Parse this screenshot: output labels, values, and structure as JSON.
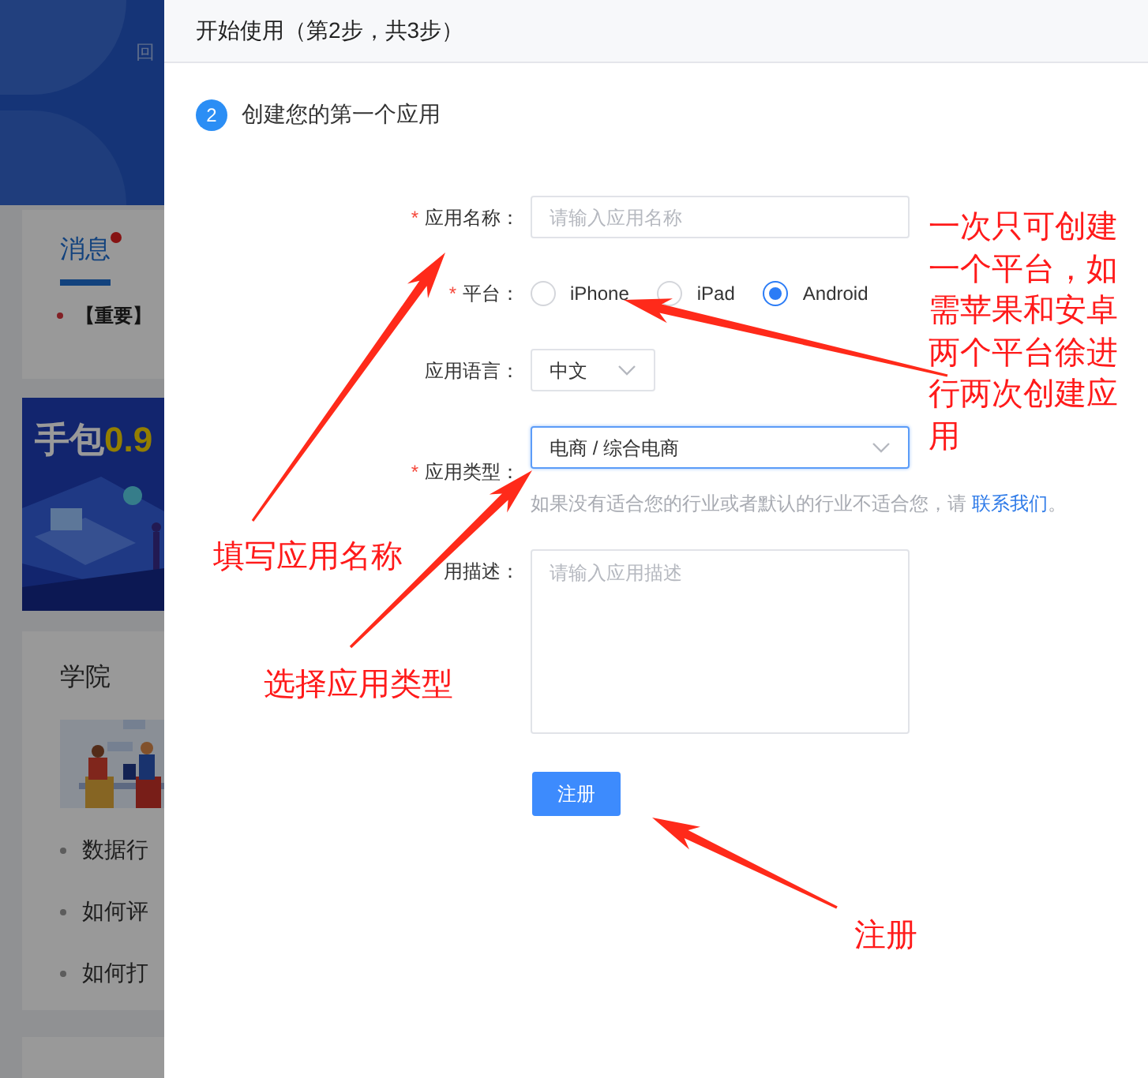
{
  "background_page": {
    "back_link": "回",
    "tabs": [
      {
        "label": "消息",
        "selected": true,
        "badge": true
      }
    ],
    "notice": "【重要】",
    "banner": {
      "title": "手包",
      "highlight": "0.9"
    },
    "academy": {
      "title": "学院",
      "articles": [
        "数据行",
        "如何评",
        "如何打"
      ]
    }
  },
  "drawer": {
    "title": "开始使用（第2步，共3步）",
    "step": {
      "number": "2",
      "title": "创建您的第一个应用"
    },
    "fields": [
      {
        "kind": "text",
        "label": "应用名称：",
        "required_mark": "*",
        "placeholder": "请输入应用名称"
      },
      {
        "kind": "radio",
        "label": "平台：",
        "required_mark": "*",
        "options": [
          {
            "label": "iPhone",
            "selected": false
          },
          {
            "label": "iPad",
            "selected": false
          },
          {
            "label": "Android",
            "selected": true
          }
        ]
      },
      {
        "kind": "short-select",
        "label": "应用语言：",
        "value": "中文",
        "focused": false
      },
      {
        "kind": "select",
        "label": "应用类型：",
        "required_mark": "*",
        "value": "电商 / 综合电商",
        "focused": true,
        "hint": "如果没有适合您的行业或者默认的行业不适合您，请 ",
        "hint_link": "联系我们",
        "hint_end": "。"
      },
      {
        "kind": "textarea",
        "label": "用描述：",
        "placeholder": "请输入应用描述"
      }
    ],
    "submit": "注册"
  },
  "annotations": [
    {
      "kind": "platform",
      "text": "一次只可创建一个平台，如需苹果和安卓两个平台徐进行两次创建应用"
    },
    {
      "kind": "name",
      "text": "填写应用名称"
    },
    {
      "kind": "type",
      "text": "选择应用类型"
    },
    {
      "kind": "submit",
      "text": "注册"
    }
  ]
}
